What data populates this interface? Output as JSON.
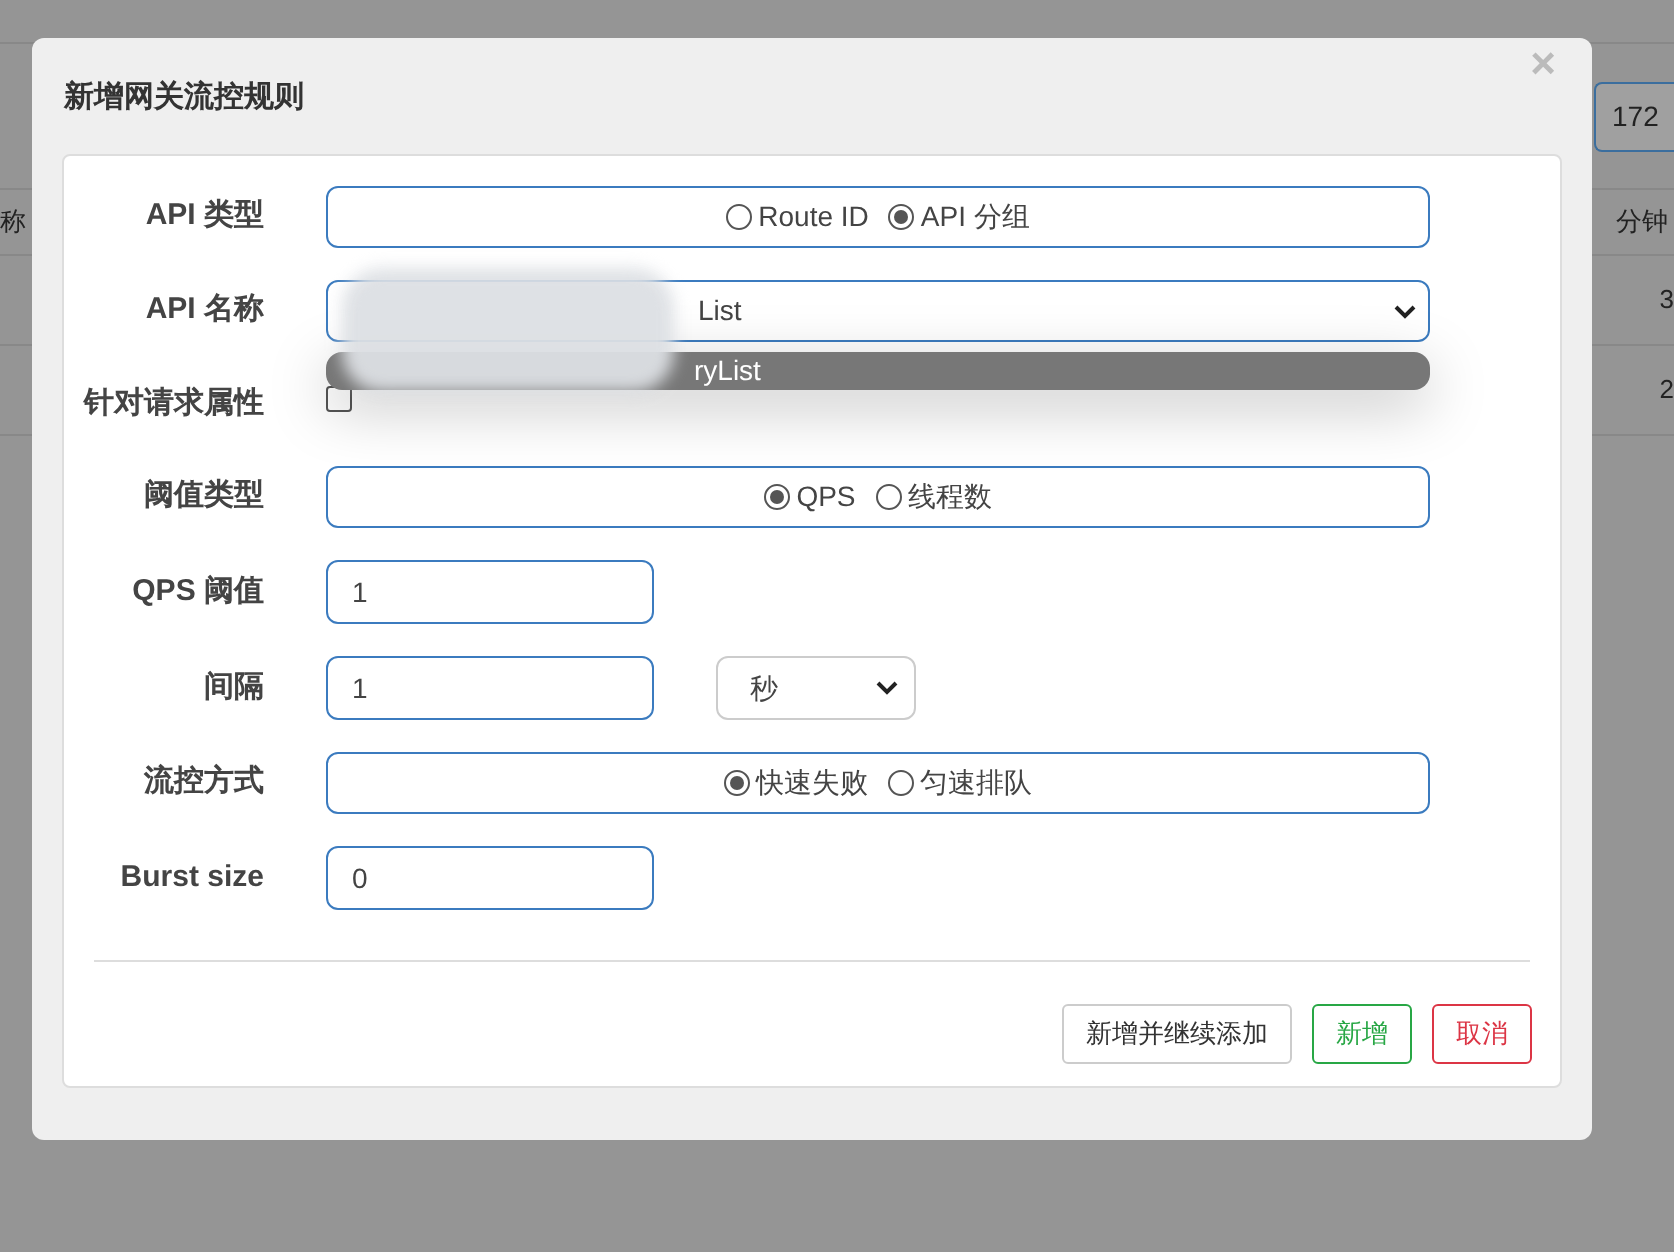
{
  "background": {
    "column_1": "称",
    "column_2": "分钟",
    "field_value": "172",
    "cells": [
      "3",
      "2"
    ]
  },
  "dialog": {
    "title": "新增网关流控规则",
    "close": "×",
    "fields": [
      {
        "kind": "radio",
        "label": "API 类型",
        "options": [
          {
            "label": "Route ID",
            "selected": false
          },
          {
            "label": "API 分组",
            "selected": true
          }
        ]
      },
      {
        "kind": "select",
        "label": "API 名称",
        "value": "List",
        "dropdown": [
          {
            "label": "ryList",
            "selected": true
          }
        ]
      },
      {
        "kind": "checkbox",
        "label": "针对请求属性",
        "checked": false
      },
      {
        "kind": "radio",
        "label": "阈值类型",
        "options": [
          {
            "label": "QPS",
            "selected": true
          },
          {
            "label": "线程数",
            "selected": false
          }
        ]
      },
      {
        "kind": "input",
        "label": "QPS 阈值",
        "value": "1"
      },
      {
        "kind": "input",
        "label": "间隔",
        "value": "1",
        "unit": "秒"
      },
      {
        "kind": "radio",
        "label": "流控方式",
        "options": [
          {
            "label": "快速失败",
            "selected": true
          },
          {
            "label": "匀速排队",
            "selected": false
          }
        ]
      },
      {
        "kind": "input",
        "label": "Burst size",
        "value": "0"
      }
    ],
    "buttons": [
      {
        "label": "新增并继续添加",
        "kind": "plain"
      },
      {
        "label": "新增",
        "kind": "confirm"
      },
      {
        "label": "取消",
        "kind": "cancel"
      }
    ]
  }
}
